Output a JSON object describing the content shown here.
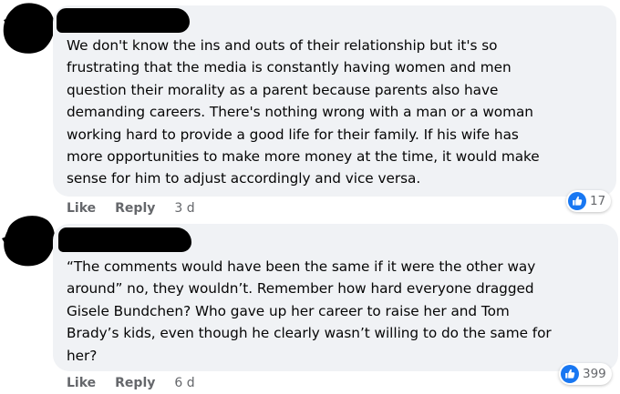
{
  "comments": [
    {
      "text": "We don't know the ins and outs of their relationship but it's so\nfrustrating that the media is constantly having women and men\nquestion their morality as a parent because parents also have\ndemanding careers. There's nothing wrong with a man or a woman\nworking hard to provide a good life for their family. If his wife has\nmore opportunities to make more money at the time, it would make\nsense for him to adjust accordingly and vice versa.",
      "like_label": "Like",
      "reply_label": "Reply",
      "time": "3 d",
      "reaction_count": "17"
    },
    {
      "text": "“The comments would have been the same if it were the other way\naround” no, they wouldn’t. Remember how hard everyone dragged\nGisele Bundchen? Who gave up her career to raise her and Tom\nBrady’s kids, even though he clearly wasn’t willing to do the same for\nher?",
      "like_label": "Like",
      "reply_label": "Reply",
      "time": "6 d",
      "reaction_count": "399"
    }
  ],
  "colors": {
    "bubble": "#f0f2f5",
    "meta": "#65676b",
    "like_blue": "#1877f2"
  },
  "icons": {
    "reaction": "thumbs-up-icon"
  }
}
